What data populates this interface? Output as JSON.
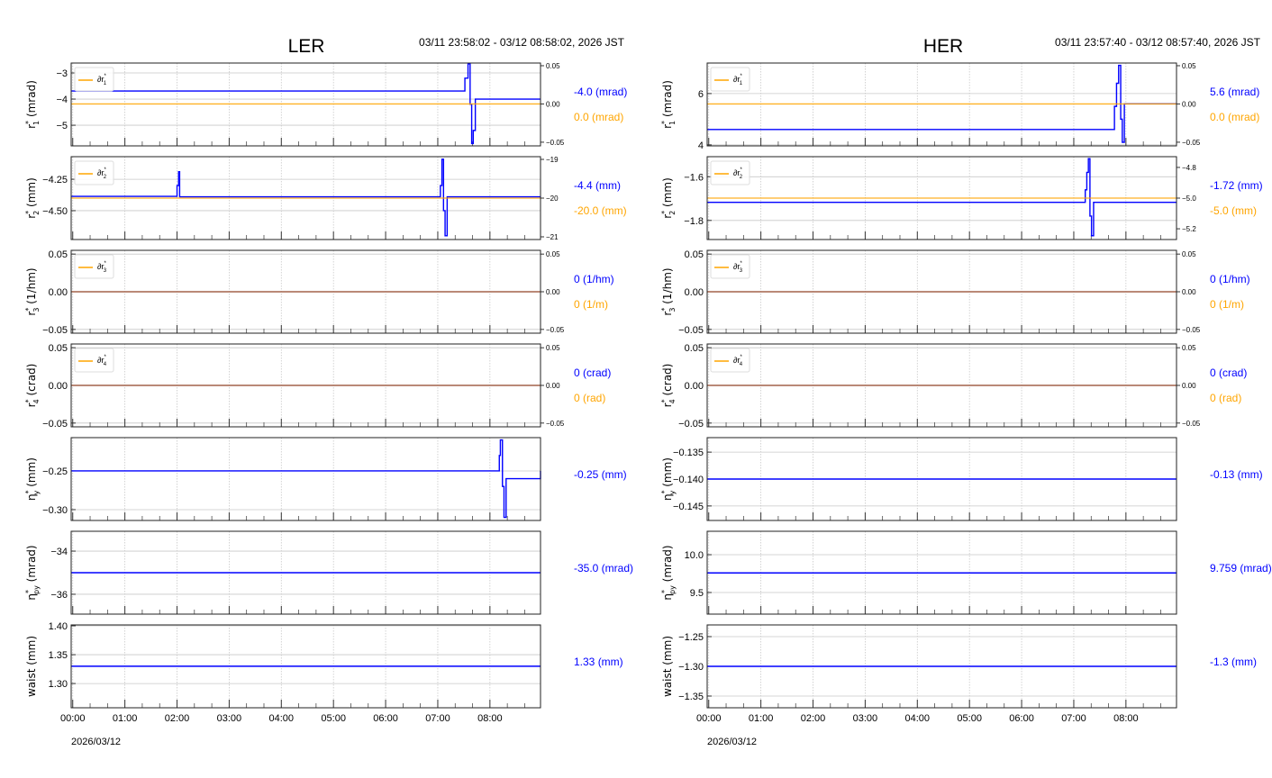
{
  "colors": {
    "measured": "#0000ff",
    "reference": "#ffa500",
    "grid": "#c8c8c8"
  },
  "chart_data": [
    {
      "type": "line",
      "title": "LER",
      "time_range": "03/11 23:58:02 - 03/12 08:58:02, 2026 JST",
      "date_label": "2026/03/12",
      "xlim": [
        -0.03,
        8.97
      ],
      "xticks": [
        0,
        1,
        2,
        3,
        4,
        5,
        6,
        7,
        8
      ],
      "xtick_labels": [
        "00:00",
        "01:00",
        "02:00",
        "03:00",
        "04:00",
        "05:00",
        "06:00",
        "07:00",
        "08:00"
      ],
      "panels": [
        {
          "ylabel": {
            "base": "r",
            "sup": "*",
            "sub": "1",
            "unit": " (mrad)"
          },
          "ylim": [
            -5.79,
            -2.62
          ],
          "yticks": [
            -3,
            -4,
            -5
          ],
          "ytick_labels": [
            "−3",
            "−4",
            "−5"
          ],
          "right": {
            "ylim": [
              -0.0548,
              0.0535
            ],
            "yticks": [
              0.05,
              0,
              -0.05
            ],
            "ytick_labels": [
              "0.05",
              "0.00",
              "−0.05"
            ],
            "ref": 0
          },
          "legend": {
            "base": "∂r",
            "sup": "*",
            "sub": "1"
          },
          "series": {
            "x": [
              -0.03,
              7.52,
              7.58,
              7.62,
              7.65,
              7.68,
              7.72,
              8.97
            ],
            "y": [
              -3.69,
              -3.2,
              -2.65,
              -4.2,
              -5.7,
              -5.2,
              -4.0,
              -4.0
            ]
          },
          "readout": "-4.0 (mrad)",
          "ref_readout": "0.0 (mrad)"
        },
        {
          "ylabel": {
            "base": "r",
            "sup": "*",
            "sub": "2",
            "unit": " (mm)"
          },
          "ylim": [
            -4.73,
            -4.07
          ],
          "yticks": [
            -4.25,
            -4.5
          ],
          "ytick_labels": [
            "−4.25",
            "−4.50"
          ],
          "right": {
            "ylim": [
              -21.07,
              -18.93
            ],
            "yticks": [
              -19,
              -20,
              -21
            ],
            "ytick_labels": [
              "−19",
              "−20",
              "−21"
            ],
            "ref": -20
          },
          "legend": {
            "base": "∂r",
            "sup": "*",
            "sub": "2"
          },
          "series": {
            "x": [
              -0.03,
              2.0,
              2.03,
              2.05,
              7.05,
              7.08,
              7.11,
              7.14,
              7.18,
              8.97
            ],
            "y": [
              -4.386,
              -4.3,
              -4.19,
              -4.39,
              -4.3,
              -4.09,
              -4.5,
              -4.7,
              -4.39,
              -4.39
            ]
          },
          "readout": "-4.4 (mm)",
          "ref_readout": "-20.0 (mm)"
        },
        {
          "ylabel": {
            "base": "r",
            "sup": "*",
            "sub": "3",
            "unit": " (1/hm)"
          },
          "ylim": [
            -0.055,
            0.055
          ],
          "yticks": [
            0.05,
            0,
            -0.05
          ],
          "ytick_labels": [
            "0.05",
            "0.00",
            "−0.05"
          ],
          "right": {
            "ylim": [
              -0.055,
              0.055
            ],
            "yticks": [
              0.05,
              0,
              -0.05
            ],
            "ytick_labels": [
              "0.05",
              "0.00",
              "−0.05"
            ],
            "ref": 0
          },
          "legend": {
            "base": "∂r",
            "sup": "*",
            "sub": "3"
          },
          "series": {
            "x": [
              -0.03,
              8.97
            ],
            "y": [
              0,
              0
            ]
          },
          "readout": "0 (1/hm)",
          "ref_readout": "0 (1/m)"
        },
        {
          "ylabel": {
            "base": "r",
            "sup": "*",
            "sub": "4",
            "unit": " (crad)"
          },
          "ylim": [
            -0.055,
            0.055
          ],
          "yticks": [
            0.05,
            0,
            -0.05
          ],
          "ytick_labels": [
            "0.05",
            "0.00",
            "−0.05"
          ],
          "right": {
            "ylim": [
              -0.055,
              0.055
            ],
            "yticks": [
              0.05,
              0,
              -0.05
            ],
            "ytick_labels": [
              "0.05",
              "0.00",
              "−0.05"
            ],
            "ref": 0
          },
          "legend": {
            "base": "∂r",
            "sup": "*",
            "sub": "4"
          },
          "series": {
            "x": [
              -0.03,
              8.97
            ],
            "y": [
              0,
              0
            ]
          },
          "readout": "0 (crad)",
          "ref_readout": "0 (rad)"
        },
        {
          "ylabel": {
            "base": "η",
            "sup": "*",
            "sub": "y",
            "unit": " (mm)"
          },
          "ylim": [
            -0.314,
            -0.207
          ],
          "yticks": [
            -0.25,
            -0.3
          ],
          "ytick_labels": [
            "−0.25",
            "−0.30"
          ],
          "series": {
            "x": [
              -0.03,
              8.18,
              8.2,
              8.24,
              8.27,
              8.31,
              8.97
            ],
            "y": [
              -0.25,
              -0.23,
              -0.21,
              -0.27,
              -0.31,
              -0.26,
              -0.25
            ]
          },
          "readout": "-0.25 (mm)"
        },
        {
          "ylabel": {
            "base": "η",
            "sup": "*",
            "sub": "py",
            "unit": " (mrad)"
          },
          "ylim": [
            -36.92,
            -33.08
          ],
          "yticks": [
            -34,
            -36
          ],
          "ytick_labels": [
            "−34",
            "−36"
          ],
          "series": {
            "x": [
              -0.03,
              8.97
            ],
            "y": [
              -35,
              -35
            ]
          },
          "readout": "-35.0 (mrad)"
        },
        {
          "ylabel": {
            "base": "waist",
            "sup": "",
            "sub": "",
            "unit": " (mm)"
          },
          "ylim": [
            1.258,
            1.4016
          ],
          "yticks": [
            1.4,
            1.35,
            1.3
          ],
          "ytick_labels": [
            "1.40",
            "1.35",
            "1.30"
          ],
          "series": {
            "x": [
              -0.03,
              8.97
            ],
            "y": [
              1.33,
              1.33
            ]
          },
          "readout": "1.33 (mm)"
        }
      ]
    },
    {
      "type": "line",
      "title": "HER",
      "time_range": "03/11 23:57:40 - 03/12 08:57:40, 2026 JST",
      "date_label": "2026/03/12",
      "xlim": [
        -0.03,
        8.97
      ],
      "xticks": [
        0,
        1,
        2,
        3,
        4,
        5,
        6,
        7,
        8
      ],
      "xtick_labels": [
        "00:00",
        "01:00",
        "02:00",
        "03:00",
        "04:00",
        "05:00",
        "06:00",
        "07:00",
        "08:00"
      ],
      "panels": [
        {
          "ylabel": {
            "base": "r",
            "sup": "*",
            "sub": "1",
            "unit": " (mrad)"
          },
          "ylim": [
            3.96,
            7.19
          ],
          "yticks": [
            6,
            4
          ],
          "ytick_labels": [
            "6",
            "4"
          ],
          "right": {
            "ylim": [
              -0.0548,
              0.0535
            ],
            "yticks": [
              0.05,
              0,
              -0.05
            ],
            "ytick_labels": [
              "0.05",
              "0.00",
              "−0.05"
            ],
            "ref": 0
          },
          "legend": {
            "base": "∂r",
            "sup": "*",
            "sub": "1"
          },
          "series": {
            "x": [
              -0.03,
              7.78,
              7.82,
              7.86,
              7.9,
              7.93,
              7.97,
              8.97
            ],
            "y": [
              4.6,
              5.5,
              6.4,
              7.1,
              5.0,
              4.1,
              5.6,
              5.6
            ]
          },
          "readout": "5.6 (mrad)",
          "ref_readout": "0.0 (mrad)"
        },
        {
          "ylabel": {
            "base": "r",
            "sup": "*",
            "sub": "2",
            "unit": " (mm)"
          },
          "ylim": [
            -1.8875,
            -1.508
          ],
          "yticks": [
            -1.6,
            -1.8
          ],
          "ytick_labels": [
            "−1.6",
            "−1.8"
          ],
          "right": {
            "ylim": [
              -5.27,
              -4.73
            ],
            "yticks": [
              -4.8,
              -5.0,
              -5.2
            ],
            "ytick_labels": [
              "−4.8",
              "−5.0",
              "−5.2"
            ],
            "ref": -5.0
          },
          "legend": {
            "base": "∂r",
            "sup": "*",
            "sub": "2"
          },
          "series": {
            "x": [
              -0.03,
              7.22,
              7.25,
              7.28,
              7.31,
              7.34,
              7.38,
              8.97
            ],
            "y": [
              -1.717,
              -1.66,
              -1.58,
              -1.517,
              -1.78,
              -1.87,
              -1.717,
              -1.717
            ]
          },
          "readout": "-1.72 (mm)",
          "ref_readout": "-5.0 (mm)"
        },
        {
          "ylabel": {
            "base": "r",
            "sup": "*",
            "sub": "3",
            "unit": " (1/hm)"
          },
          "ylim": [
            -0.055,
            0.055
          ],
          "yticks": [
            0.05,
            0,
            -0.05
          ],
          "ytick_labels": [
            "0.05",
            "0.00",
            "−0.05"
          ],
          "right": {
            "ylim": [
              -0.055,
              0.055
            ],
            "yticks": [
              0.05,
              0,
              -0.05
            ],
            "ytick_labels": [
              "0.05",
              "0.00",
              "−0.05"
            ],
            "ref": 0
          },
          "legend": {
            "base": "∂r",
            "sup": "*",
            "sub": "3"
          },
          "series": {
            "x": [
              -0.03,
              8.97
            ],
            "y": [
              0,
              0
            ]
          },
          "readout": "0 (1/hm)",
          "ref_readout": "0 (1/m)"
        },
        {
          "ylabel": {
            "base": "r",
            "sup": "*",
            "sub": "4",
            "unit": " (crad)"
          },
          "ylim": [
            -0.055,
            0.055
          ],
          "yticks": [
            0.05,
            0,
            -0.05
          ],
          "ytick_labels": [
            "0.05",
            "0.00",
            "−0.05"
          ],
          "right": {
            "ylim": [
              -0.055,
              0.055
            ],
            "yticks": [
              0.05,
              0,
              -0.05
            ],
            "ytick_labels": [
              "0.05",
              "0.00",
              "−0.05"
            ],
            "ref": 0
          },
          "legend": {
            "base": "∂r",
            "sup": "*",
            "sub": "4"
          },
          "series": {
            "x": [
              -0.03,
              8.97
            ],
            "y": [
              0,
              0
            ]
          },
          "readout": "0 (crad)",
          "ref_readout": "0 (rad)"
        },
        {
          "ylabel": {
            "base": "η",
            "sup": "*",
            "sub": "y",
            "unit": " (mm)"
          },
          "ylim": [
            -0.1477,
            -0.1323
          ],
          "yticks": [
            -0.135,
            -0.14,
            -0.145
          ],
          "ytick_labels": [
            "−0.135",
            "−0.140",
            "−0.145"
          ],
          "series": {
            "x": [
              -0.03,
              8.97
            ],
            "y": [
              -0.14,
              -0.14
            ]
          },
          "readout": "-0.13 (mm)"
        },
        {
          "ylabel": {
            "base": "η",
            "sup": "*",
            "sub": "py",
            "unit": " (mrad)"
          },
          "ylim": [
            9.214,
            10.31
          ],
          "yticks": [
            10.0,
            9.5
          ],
          "ytick_labels": [
            "10.0",
            "9.5"
          ],
          "series": {
            "x": [
              -0.03,
              8.97
            ],
            "y": [
              9.759,
              9.759
            ]
          },
          "readout": "9.759 (mrad)"
        },
        {
          "ylabel": {
            "base": "waist",
            "sup": "",
            "sub": "",
            "unit": " (mm)"
          },
          "ylim": [
            -1.3697,
            -1.2303
          ],
          "yticks": [
            -1.25,
            -1.3,
            -1.35
          ],
          "ytick_labels": [
            "−1.25",
            "−1.30",
            "−1.35"
          ],
          "series": {
            "x": [
              -0.03,
              8.97
            ],
            "y": [
              -1.3,
              -1.3
            ]
          },
          "readout": "-1.3 (mm)"
        }
      ]
    }
  ]
}
